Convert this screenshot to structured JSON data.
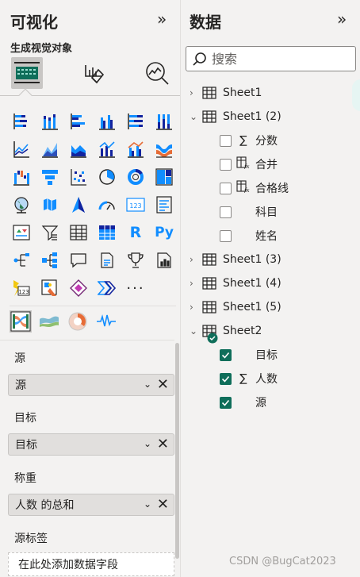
{
  "visualizations": {
    "title": "可视化",
    "collapse_icon": "double-chevron-right-icon",
    "subtitle": "生成视觉对象",
    "modes": [
      "build-visual-icon",
      "format-visual-icon",
      "analytics-icon"
    ],
    "wells": [
      {
        "label": "源",
        "value": "源"
      },
      {
        "label": "目标",
        "value": "目标"
      },
      {
        "label": "称重",
        "value": "人数 的总和"
      }
    ],
    "source_label_well": {
      "label": "源标签",
      "placeholder": "在此处添加数据字段"
    }
  },
  "data": {
    "title": "数据",
    "collapse_icon": "double-chevron-right-icon",
    "search_placeholder": "搜索",
    "tables": [
      {
        "name": "Sheet1",
        "expanded": false
      },
      {
        "name": "Sheet1 (2)",
        "expanded": true,
        "fields": [
          {
            "name": "分数",
            "type": "sum",
            "checked": false
          },
          {
            "name": "合并",
            "type": "calc",
            "checked": false
          },
          {
            "name": "合格线",
            "type": "calc",
            "checked": false
          },
          {
            "name": "科目",
            "type": "text",
            "checked": false
          },
          {
            "name": "姓名",
            "type": "text",
            "checked": false
          }
        ]
      },
      {
        "name": "Sheet1 (3)",
        "expanded": false
      },
      {
        "name": "Sheet1 (4)",
        "expanded": false
      },
      {
        "name": "Sheet1 (5)",
        "expanded": false
      },
      {
        "name": "Sheet2",
        "expanded": true,
        "fields": [
          {
            "name": "目标",
            "type": "text",
            "checked": true
          },
          {
            "name": "人数",
            "type": "sum",
            "checked": true
          },
          {
            "name": "源",
            "type": "text",
            "checked": true
          }
        ]
      }
    ]
  },
  "watermark": "CSDN @BugCat2023",
  "colors": {
    "accent": "#0f6e5a",
    "pane_bg": "#f3f2f1",
    "chart_blue": "#118dff",
    "chart_dark": "#12239e"
  }
}
